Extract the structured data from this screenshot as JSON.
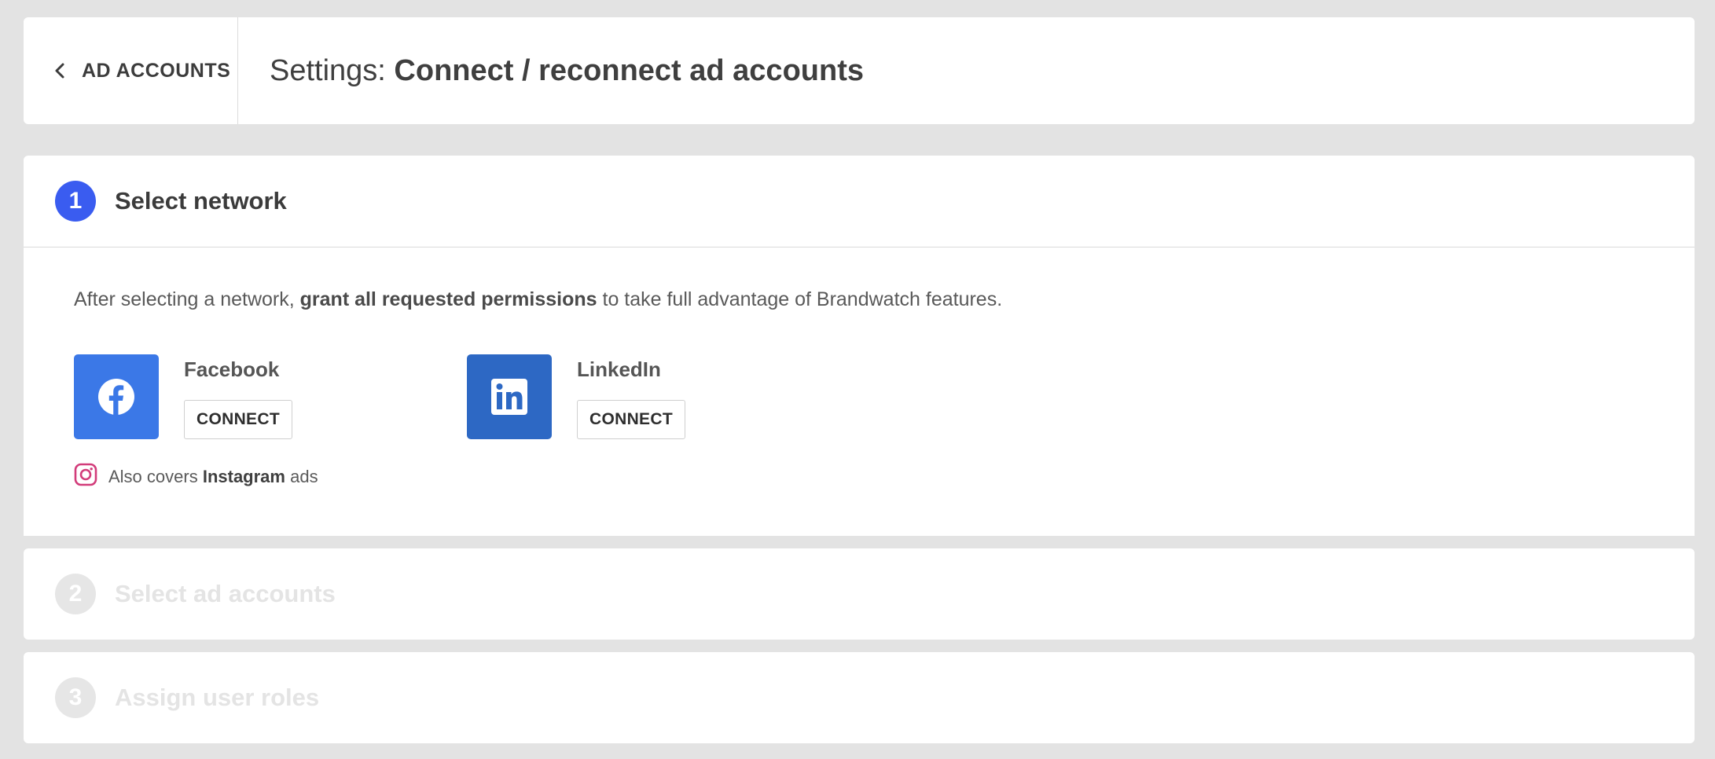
{
  "header": {
    "back_label": "AD ACCOUNTS",
    "title_prefix": "Settings: ",
    "title_bold": "Connect / reconnect ad accounts"
  },
  "steps": [
    {
      "number": "1",
      "title": "Select network",
      "state": "active"
    },
    {
      "number": "2",
      "title": "Select ad accounts",
      "state": "inactive"
    },
    {
      "number": "3",
      "title": "Assign user roles",
      "state": "inactive"
    }
  ],
  "intro": {
    "before": "After selecting a network, ",
    "bold": "grant all requested permissions",
    "after": " to take full advantage of Brandwatch features."
  },
  "networks": [
    {
      "name": "Facebook",
      "button": "CONNECT",
      "icon": "facebook-icon",
      "color": "#3b78e7"
    },
    {
      "name": "LinkedIn",
      "button": "CONNECT",
      "icon": "linkedin-icon",
      "color": "#2d68c4"
    }
  ],
  "instagram_note": {
    "before": "Also covers ",
    "bold": "Instagram",
    "after": " ads",
    "icon": "instagram-icon"
  },
  "colors": {
    "accent": "#3a5cf0",
    "background": "#e3e3e3",
    "instagram": "#d23c7a"
  }
}
